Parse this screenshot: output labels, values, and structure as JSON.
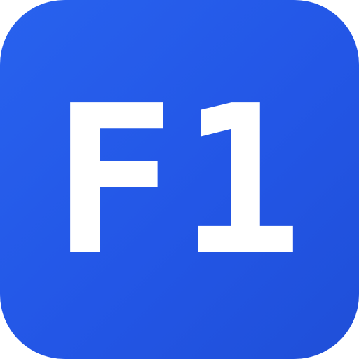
{
  "icon": {
    "label": "F1",
    "background_colors": [
      "#2862ee",
      "#2356e6",
      "#1f4fd8"
    ],
    "text_color": "#ffffff"
  }
}
